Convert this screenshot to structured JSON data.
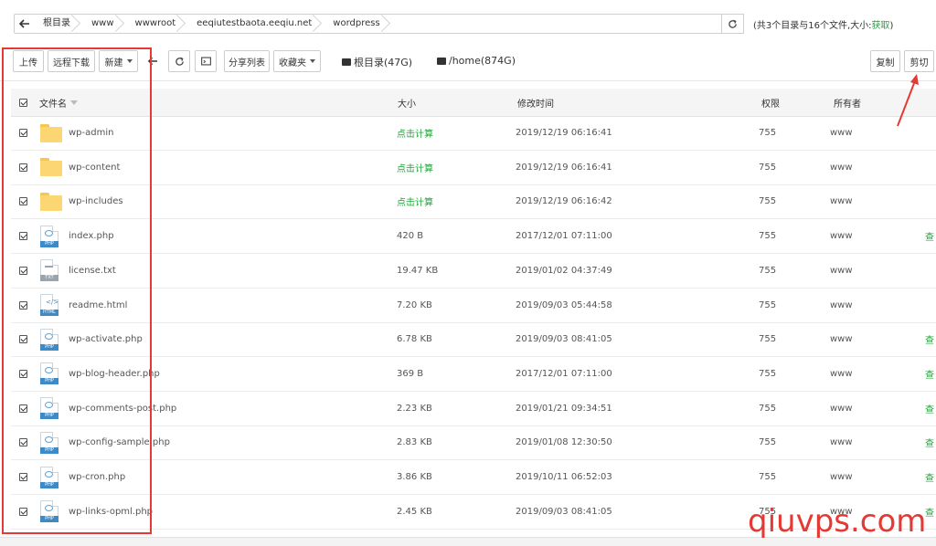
{
  "pathbar": {
    "crumbs": [
      "根目录",
      "www",
      "wwwroot",
      "eeqiutestbaota.eeqiu.net",
      "wordpress"
    ],
    "summary_prefix": "(共3个目录与16个文件,大小:",
    "summary_link": "获取",
    "summary_suffix": ")"
  },
  "toolbar": {
    "upload": "上传",
    "remote_download": "远程下载",
    "new": "新建",
    "share_list": "分享列表",
    "favorites": "收藏夹",
    "disk_root": "根目录(47G)",
    "disk_home": "/home(874G)",
    "copy": "复制",
    "cut": "剪切"
  },
  "table": {
    "headers": {
      "name": "文件名",
      "size": "大小",
      "mtime": "修改时间",
      "perm": "权限",
      "owner": "所有者"
    },
    "rows": [
      {
        "type": "folder",
        "name": "wp-admin",
        "size": "点击计算",
        "mtime": "2019/12/19 06:16:41",
        "perm": "755",
        "owner": "www",
        "action": ""
      },
      {
        "type": "folder",
        "name": "wp-content",
        "size": "点击计算",
        "mtime": "2019/12/19 06:16:41",
        "perm": "755",
        "owner": "www",
        "action": ""
      },
      {
        "type": "folder",
        "name": "wp-includes",
        "size": "点击计算",
        "mtime": "2019/12/19 06:16:42",
        "perm": "755",
        "owner": "www",
        "action": ""
      },
      {
        "type": "php",
        "name": "index.php",
        "size": "420 B",
        "mtime": "2017/12/01 07:11:00",
        "perm": "755",
        "owner": "www",
        "action": "查"
      },
      {
        "type": "txt",
        "name": "license.txt",
        "size": "19.47 KB",
        "mtime": "2019/01/02 04:37:49",
        "perm": "755",
        "owner": "www",
        "action": ""
      },
      {
        "type": "html",
        "name": "readme.html",
        "size": "7.20 KB",
        "mtime": "2019/09/03 05:44:58",
        "perm": "755",
        "owner": "www",
        "action": ""
      },
      {
        "type": "php",
        "name": "wp-activate.php",
        "size": "6.78 KB",
        "mtime": "2019/09/03 08:41:05",
        "perm": "755",
        "owner": "www",
        "action": "查"
      },
      {
        "type": "php",
        "name": "wp-blog-header.php",
        "size": "369 B",
        "mtime": "2017/12/01 07:11:00",
        "perm": "755",
        "owner": "www",
        "action": "查"
      },
      {
        "type": "php",
        "name": "wp-comments-post.php",
        "size": "2.23 KB",
        "mtime": "2019/01/21 09:34:51",
        "perm": "755",
        "owner": "www",
        "action": "查"
      },
      {
        "type": "php",
        "name": "wp-config-sample.php",
        "size": "2.83 KB",
        "mtime": "2019/01/08 12:30:50",
        "perm": "755",
        "owner": "www",
        "action": "查"
      },
      {
        "type": "php",
        "name": "wp-cron.php",
        "size": "3.86 KB",
        "mtime": "2019/10/11 06:52:03",
        "perm": "755",
        "owner": "www",
        "action": "查"
      },
      {
        "type": "php",
        "name": "wp-links-opml.php",
        "size": "2.45 KB",
        "mtime": "2019/09/03 08:41:05",
        "perm": "755",
        "owner": "www",
        "action": "查"
      }
    ]
  },
  "icons": {
    "back": "back-arrow-icon",
    "refresh": "refresh-icon",
    "terminal": "terminal-icon",
    "disk": "disk-icon"
  },
  "colors": {
    "accent_green": "#20a53a",
    "annotation_red": "#e53935",
    "folder_yellow": "#fcd673",
    "php_blue": "#3d8ac9"
  },
  "watermark": "qiuvps.com"
}
